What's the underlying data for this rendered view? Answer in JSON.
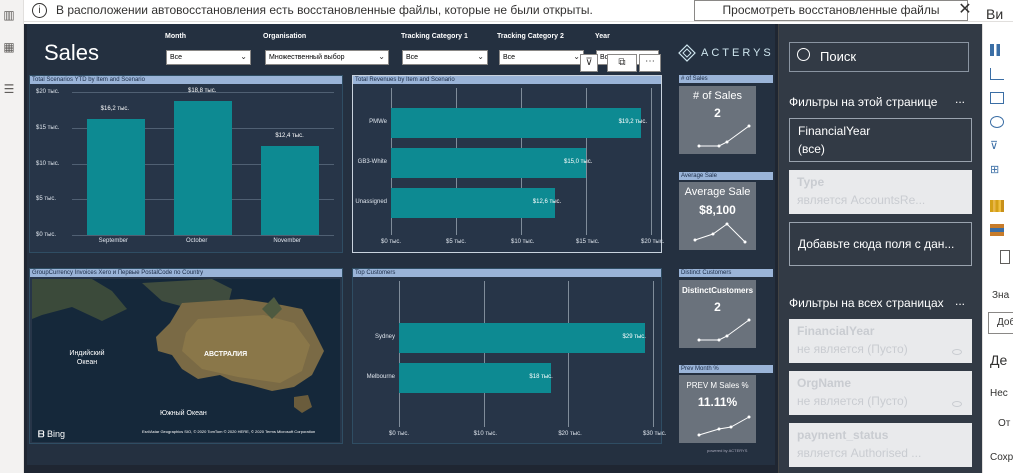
{
  "infobar": {
    "icon": "i",
    "message": "В расположении автовосстановления есть восстановленные файлы, которые не были открыты.",
    "button": "Просмотреть восстановленные файлы",
    "close": "✕"
  },
  "report": {
    "title": "Sales",
    "brand": "ACTERYS",
    "powered_by": "powered by ACTERYS",
    "slicers": [
      {
        "label": "Month",
        "value": "Все"
      },
      {
        "label": "Organisation",
        "value": "Множественный выбор"
      },
      {
        "label": "Tracking Category 1",
        "value": "Все"
      },
      {
        "label": "Tracking Category 2",
        "value": "Все"
      },
      {
        "label": "Year",
        "value": "Все"
      }
    ],
    "ytd_chart": {
      "header": "Total Scenarios YTD by Item and Scenario",
      "yticks": [
        "$20 тыс.",
        "$15 тыс.",
        "$10 тыс.",
        "$5 тыс.",
        "$0 тыс."
      ]
    },
    "rev_chart": {
      "header": "Total Revenues by Item and Scenario",
      "xticks": [
        "$0 тыс.",
        "$5 тыс.",
        "$10 тыс.",
        "$15 тыс.",
        "$20 тыс."
      ]
    },
    "map": {
      "header": "GroupCurrency Invoices Xero и Первые PostalCode по Country",
      "label_indian": "Индийский Океан",
      "label_australia": "АВСТРАЛИЯ",
      "label_south": "Южный Океан",
      "bing": "Bing",
      "credits": "Esri/Astar Geographics SIO, © 2020 TomTom © 2020 HERE, © 2020 Terms Microsoft Corporation"
    },
    "top_customers": {
      "header": "Top Customers",
      "xticks": [
        "$0 тыс.",
        "$10 тыс.",
        "$20 тыс.",
        "$30 тыс."
      ]
    },
    "kpis": [
      {
        "header": "# of Sales",
        "title": "# of Sales",
        "value": "2"
      },
      {
        "header": "Average Sale",
        "title": "Average Sale",
        "value": "$8,100"
      },
      {
        "header": "Distinct Customers",
        "title": "DistinctCustomers",
        "value": "2"
      },
      {
        "header": "Prev Month %",
        "title": "PREV M Sales %",
        "value": "11.11%"
      }
    ]
  },
  "chart_data": [
    {
      "type": "bar",
      "title": "Total Scenarios YTD by Item and Scenario",
      "categories": [
        "September",
        "October",
        "November"
      ],
      "values": [
        16.2,
        18.8,
        12.4
      ],
      "data_labels": [
        "$16,2 тыс.",
        "$18,8 тыс.",
        "$12,4 тыс."
      ],
      "ylim": [
        0,
        20
      ],
      "grid": true
    },
    {
      "type": "bar",
      "orientation": "horizontal",
      "title": "Total Revenues by Item and Scenario",
      "categories": [
        "PMWe",
        "GB3-White",
        "Unassigned"
      ],
      "values": [
        19.2,
        15.0,
        12.6
      ],
      "data_labels": [
        "$19,2 тыс.",
        "$15,0 тыс.",
        "$12,6 тыс."
      ],
      "xlim": [
        0,
        20
      ],
      "grid": true
    },
    {
      "type": "bar",
      "orientation": "horizontal",
      "title": "Top Customers",
      "categories": [
        "Sydney",
        "Melbourne"
      ],
      "values": [
        29,
        18
      ],
      "data_labels": [
        "$29 тыс.",
        "$18 тыс."
      ],
      "xlim": [
        0,
        30
      ],
      "grid": true
    }
  ],
  "filters": {
    "search_placeholder": "Поиск",
    "page_section": "Фильтры на этой странице",
    "all_section": "Фильтры на всех страницах",
    "more": "...",
    "page_filters": [
      {
        "name": "FinancialYear",
        "value": "(все)",
        "style": "active"
      },
      {
        "name": "Type",
        "value": "является AccountsRe...",
        "style": "grey"
      },
      {
        "name": "Добавьте сюда поля с дан...",
        "value": "",
        "style": "drop"
      }
    ],
    "all_filters": [
      {
        "name": "FinancialYear",
        "value": "не является (Пусто)"
      },
      {
        "name": "OrgName",
        "value": "не является (Пусто)"
      },
      {
        "name": "payment_status",
        "value": "является Authorised ..."
      }
    ]
  },
  "vizpane": {
    "header": "Ви",
    "values_label": "Зна",
    "add_label": "Доб",
    "de_label": "Де",
    "nes_label": "Нес",
    "ot_label": "От",
    "save_label": "Сохр"
  }
}
